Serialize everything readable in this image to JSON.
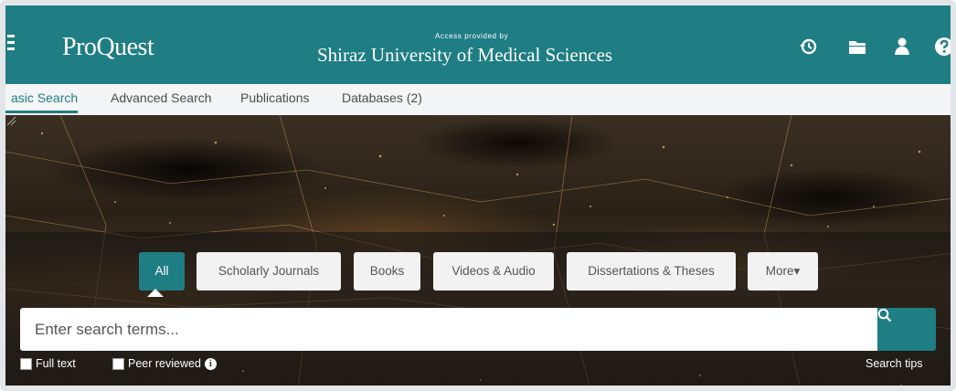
{
  "header": {
    "logo": "ProQuest",
    "access_small": "Access provided by",
    "institution": "Shiraz University of Medical Sciences",
    "icons": [
      "history-icon",
      "folder-icon",
      "user-icon",
      "help-icon"
    ]
  },
  "nav": {
    "tabs": [
      {
        "label": "asic Search",
        "active": true
      },
      {
        "label": "Advanced Search",
        "active": false
      },
      {
        "label": "Publications",
        "active": false
      },
      {
        "label": "Databases (2)",
        "active": false
      }
    ]
  },
  "filters": {
    "pills": [
      {
        "label": "All",
        "active": true
      },
      {
        "label": "Scholarly Journals",
        "active": false
      },
      {
        "label": "Books",
        "active": false
      },
      {
        "label": "Videos & Audio",
        "active": false
      },
      {
        "label": "Dissertations & Theses",
        "active": false
      },
      {
        "label": "More▾",
        "active": false
      }
    ]
  },
  "search": {
    "placeholder": "Enter search terms...",
    "value": ""
  },
  "options": {
    "full_text": "Full text",
    "peer_reviewed": "Peer reviewed",
    "search_tips": "Search tips"
  },
  "colors": {
    "brand": "#1f7d84",
    "nav_bg": "#f4f5f6",
    "pill_bg": "#f2f2f2"
  }
}
